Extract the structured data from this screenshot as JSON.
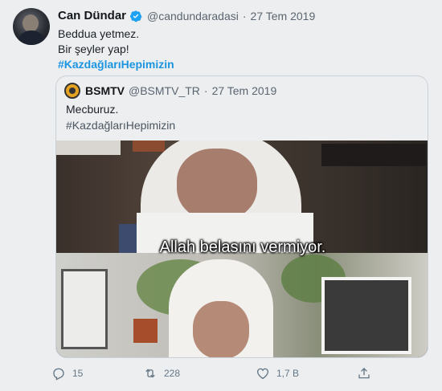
{
  "tweet": {
    "author_name": "Can Dündar",
    "author_handle": "@candundaradasi",
    "separator": "·",
    "date": "27 Tem 2019",
    "lines": [
      "Beddua yetmez.",
      "Bir şeyler yap!"
    ],
    "hashtag": "#KazdağlarıHepimizin",
    "verified_icon": "verified-badge-icon",
    "colors": {
      "link": "#1b95e0",
      "verified": "#1da1f2",
      "muted": "#657786"
    }
  },
  "quoted_tweet": {
    "author_name": "BSMTV",
    "author_handle": "@BSMTV_TR",
    "separator": "·",
    "date": "27 Tem 2019",
    "text": "Mecburuz.",
    "hashtag": "#KazdağlarıHepimizin",
    "video_subtitle": "Allah belasını vermiyor."
  },
  "actions": {
    "reply": {
      "icon": "reply-icon",
      "count": "15"
    },
    "retweet": {
      "icon": "retweet-icon",
      "count": "228"
    },
    "like": {
      "icon": "heart-icon",
      "count": "1,7 B"
    },
    "share": {
      "icon": "share-icon",
      "count": ""
    }
  }
}
